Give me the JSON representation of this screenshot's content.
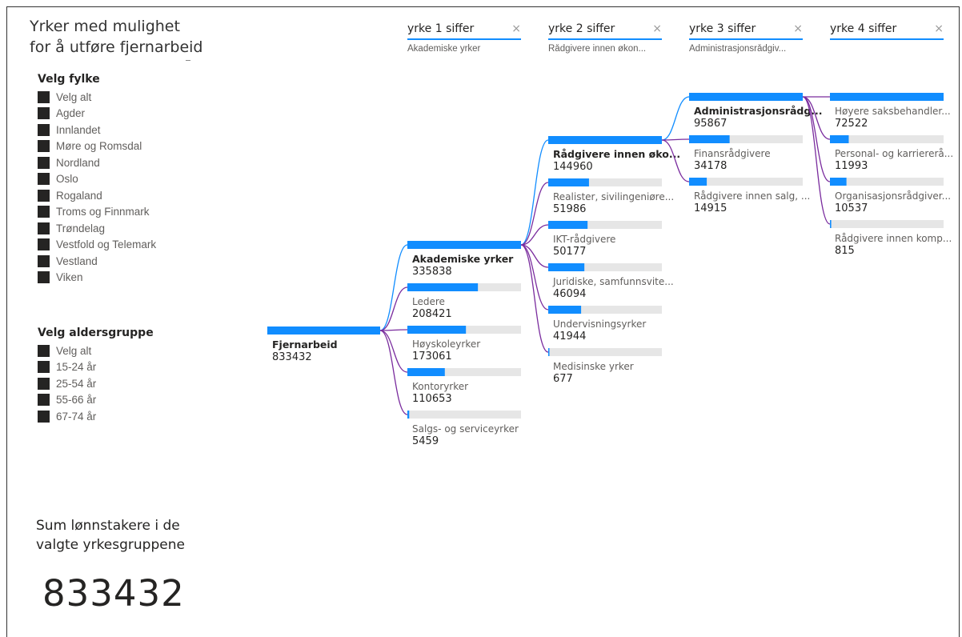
{
  "title": {
    "line1": "Yrker med mulighet",
    "line2": "for å utføre fjernarbeid"
  },
  "fylke": {
    "heading": "Velg fylke",
    "items": [
      "Velg alt",
      "Agder",
      "Innlandet",
      "Møre og Romsdal",
      "Nordland",
      "Oslo",
      "Rogaland",
      "Troms og Finnmark",
      "Trøndelag",
      "Vestfold og Telemark",
      "Vestland",
      "Viken"
    ]
  },
  "alder": {
    "heading": "Velg aldersgruppe",
    "items": [
      "Velg alt",
      "15-24 år",
      "25-54 år",
      "55-66 år",
      "67-74 år"
    ]
  },
  "sum": {
    "label1": "Sum lønnstakere i de",
    "label2": "valgte yrkesgruppene",
    "value": "833432"
  },
  "levels": [
    {
      "header": "yrke 1 siffer",
      "selected": "Akademiske yrker",
      "close": "×"
    },
    {
      "header": "yrke 2 siffer",
      "selected": "Rådgivere innen økon...",
      "close": "×"
    },
    {
      "header": "yrke 3 siffer",
      "selected": "Administrasjonsrådgiv...",
      "close": "×"
    },
    {
      "header": "yrke 4 siffer",
      "selected": "",
      "close": "×"
    }
  ],
  "colors": {
    "accent": "#118dff",
    "track": "#e6e6e6",
    "link_selected": "#118dff",
    "link_other": "#7a2c9e"
  },
  "chart_data": {
    "type": "decomposition-tree",
    "root": {
      "label": "Fjernarbeid",
      "value": 833432
    },
    "columns": [
      {
        "parent": "Fjernarbeid",
        "max": 335838,
        "nodes": [
          {
            "label": "Akademiske yrker",
            "value": 335838,
            "selected": true
          },
          {
            "label": "Ledere",
            "value": 208421
          },
          {
            "label": "Høyskoleyrker",
            "value": 173061
          },
          {
            "label": "Kontoryrker",
            "value": 110653
          },
          {
            "label": "Salgs- og serviceyrker",
            "value": 5459
          }
        ]
      },
      {
        "parent": "Akademiske yrker",
        "max": 144960,
        "nodes": [
          {
            "label": "Rådgivere innen øko...",
            "value": 144960,
            "selected": true
          },
          {
            "label": "Realister, sivilingeniøre...",
            "value": 51986
          },
          {
            "label": "IKT-rådgivere",
            "value": 50177
          },
          {
            "label": "Juridiske, samfunnsvite...",
            "value": 46094
          },
          {
            "label": "Undervisningsyrker",
            "value": 41944
          },
          {
            "label": "Medisinske yrker",
            "value": 677
          }
        ]
      },
      {
        "parent": "Rådgivere innen øko...",
        "max": 95867,
        "nodes": [
          {
            "label": "Administrasjonsrådg...",
            "value": 95867,
            "selected": true
          },
          {
            "label": "Finansrådgivere",
            "value": 34178
          },
          {
            "label": "Rådgivere innen salg, ...",
            "value": 14915
          }
        ]
      },
      {
        "parent": "Administrasjonsrådg...",
        "max": 72522,
        "nodes": [
          {
            "label": "Høyere saksbehandler...",
            "value": 72522
          },
          {
            "label": "Personal- og karriererå...",
            "value": 11993
          },
          {
            "label": "Organisasjonsrådgiver...",
            "value": 10537
          },
          {
            "label": "Rådgivere innen komp...",
            "value": 815
          }
        ]
      }
    ]
  }
}
